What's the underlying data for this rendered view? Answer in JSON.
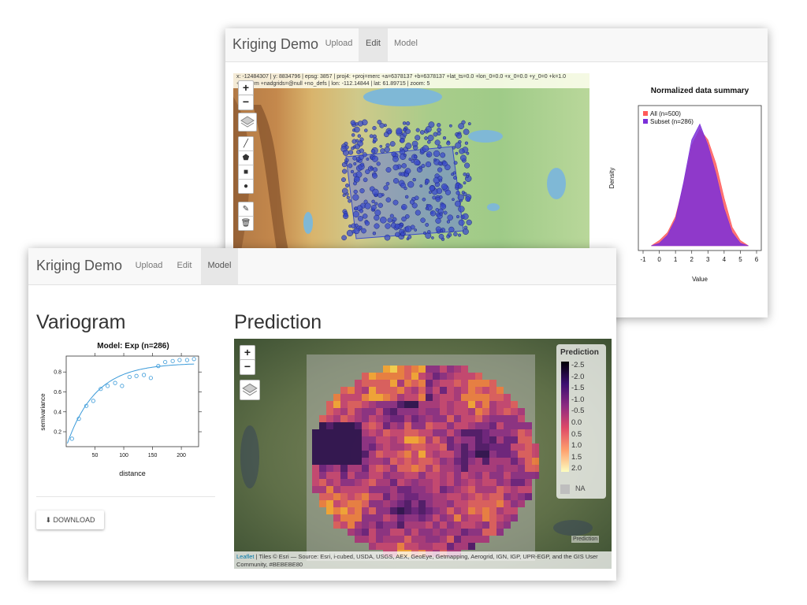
{
  "back_window": {
    "brand": "Kriging Demo",
    "tabs": [
      {
        "label": "Upload",
        "active": false
      },
      {
        "label": "Edit",
        "active": true
      },
      {
        "label": "Model",
        "active": false
      }
    ],
    "map_info_line1": "x: -12484307 | y: 8834796 | epsg: 3857 | proj4: +proj=merc +a=6378137 +b=6378137 +lat_ts=0.0 +lon_0=0.0 +x_0=0.0 +y_0=0 +k=1.0",
    "map_info_line2": "+units=m +nadgrids=@null +no_defs | lon: -112.14844 | lat: 61.89715 | zoom: 5",
    "zoom_in": "+",
    "zoom_out": "−",
    "summary_chart": {
      "title": "Normalized data summary",
      "ylabel": "Density",
      "xlabel": "Value",
      "xticks": [
        "-1",
        "0",
        "1",
        "2",
        "3",
        "4",
        "5",
        "6"
      ],
      "legend": [
        {
          "label": "All (n=500)",
          "color": "#ff5a5a"
        },
        {
          "label": "Subset (n=286)",
          "color": "#7b2fd9"
        }
      ]
    }
  },
  "front_window": {
    "brand": "Kriging Demo",
    "tabs": [
      {
        "label": "Upload",
        "active": false
      },
      {
        "label": "Edit",
        "active": false
      },
      {
        "label": "Model",
        "active": true
      }
    ],
    "variogram_heading": "Variogram",
    "prediction_heading": "Prediction",
    "download_label": "DOWNLOAD",
    "zoom_in": "+",
    "zoom_out": "−",
    "legend_title": "Prediction",
    "legend_ticks": [
      "-2.5",
      "-2.0",
      "-1.5",
      "-1.0",
      "-0.5",
      "0.0",
      "0.5",
      "1.0",
      "1.5",
      "2.0"
    ],
    "legend_na": "NA",
    "overlay_label": "Prediction",
    "attribution_link": "Leaflet",
    "attribution_text": " | Tiles © Esri — Source: Esri, i-cubed, USDA, USGS, AEX, GeoEye, Getmapping, Aerogrid, IGN, IGP, UPR-EGP, and the GIS User Community, #BEBEBE80"
  },
  "chart_data": [
    {
      "type": "scatter",
      "title": "Model: Exp (n=286)",
      "xlabel": "distance",
      "ylabel": "semivariance",
      "xlim": [
        0,
        230
      ],
      "ylim": [
        0.05,
        0.96
      ],
      "xticks": [
        50,
        100,
        150,
        200
      ],
      "yticks": [
        0.2,
        0.4,
        0.6,
        0.8
      ],
      "series": [
        {
          "name": "",
          "kind": "points",
          "x": [
            10,
            22,
            35,
            47,
            60,
            72,
            85,
            97,
            110,
            122,
            135,
            147,
            160,
            172,
            185,
            197,
            210,
            222
          ],
          "y": [
            0.13,
            0.33,
            0.46,
            0.51,
            0.63,
            0.66,
            0.69,
            0.66,
            0.75,
            0.76,
            0.77,
            0.74,
            0.86,
            0.9,
            0.91,
            0.92,
            0.92,
            0.93
          ]
        },
        {
          "name": "",
          "kind": "line",
          "model": "exponential"
        }
      ]
    },
    {
      "type": "area",
      "title": "Normalized data summary",
      "xlabel": "Value",
      "ylabel": "Density",
      "xlim": [
        -1,
        6
      ],
      "series": [
        {
          "name": "All (n=500)",
          "x": [
            -0.5,
            0,
            0.5,
            1,
            1.5,
            2,
            2.5,
            3,
            3.5,
            4,
            4.5,
            5,
            5.5
          ],
          "y": [
            0.0,
            0.02,
            0.05,
            0.11,
            0.23,
            0.38,
            0.44,
            0.4,
            0.31,
            0.18,
            0.07,
            0.02,
            0.0
          ]
        },
        {
          "name": "Subset (n=286)",
          "x": [
            -0.5,
            0,
            0.5,
            1,
            1.5,
            2,
            2.5,
            3,
            3.5,
            4,
            4.5,
            5,
            5.5
          ],
          "y": [
            0.0,
            0.01,
            0.04,
            0.1,
            0.24,
            0.4,
            0.46,
            0.38,
            0.27,
            0.14,
            0.05,
            0.01,
            0.0
          ]
        }
      ]
    }
  ]
}
